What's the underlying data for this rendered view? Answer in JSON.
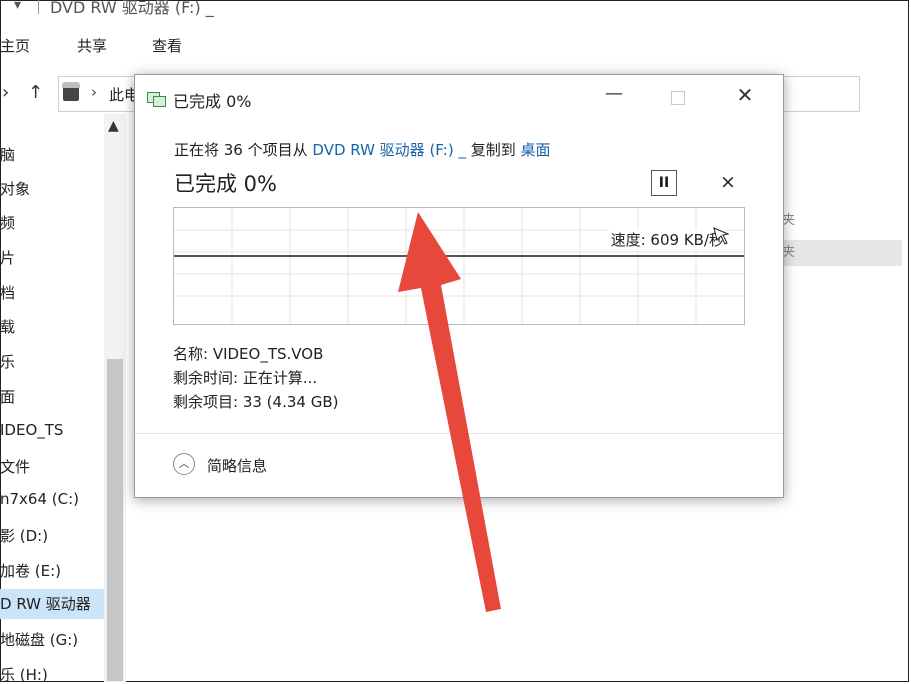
{
  "explorer": {
    "window_title": "DVD RW 驱动器 (F:) _",
    "quick_access": "▾",
    "ribbon_tabs": [
      "主页",
      "共享",
      "查看"
    ],
    "address": {
      "crumb": "此电"
    },
    "sidebar_items": [
      {
        "label": "脑"
      },
      {
        "label": "对象"
      },
      {
        "label": "频"
      },
      {
        "label": "片"
      },
      {
        "label": "档"
      },
      {
        "label": "载"
      },
      {
        "label": "乐"
      },
      {
        "label": "面"
      },
      {
        "label": "IDEO_TS"
      },
      {
        "label": "文件"
      },
      {
        "label": "n7x64 (C:)"
      },
      {
        "label": "影 (D:)"
      },
      {
        "label": "加卷 (E:)"
      },
      {
        "label": "D RW 驱动器"
      },
      {
        "label": "地磁盘 (G:)"
      },
      {
        "label": "乐 (H:)"
      }
    ],
    "right_fragments": [
      "夹",
      "夹"
    ]
  },
  "dialog": {
    "title": "已完成 0%",
    "copy_line": {
      "prefix": "正在将 36 个项目从 ",
      "source": "DVD RW 驱动器 (F:) _",
      "mid": " 复制到 ",
      "dest": "桌面"
    },
    "progress_title": "已完成 0%",
    "pause_label": "II",
    "cancel_label": "×",
    "speed": "速度: 609 KB/秒",
    "name": "名称: VIDEO_TS.VOB",
    "time_remaining": "剩余时间: 正在计算...",
    "items_remaining": "剩余项目: 33 (4.34 GB)",
    "less_details": "简略信息",
    "progress_fraction": 0.0
  },
  "colors": {
    "link": "#1a63a8",
    "annotation_arrow": "#e8473b",
    "selection": "#cce4f7"
  }
}
